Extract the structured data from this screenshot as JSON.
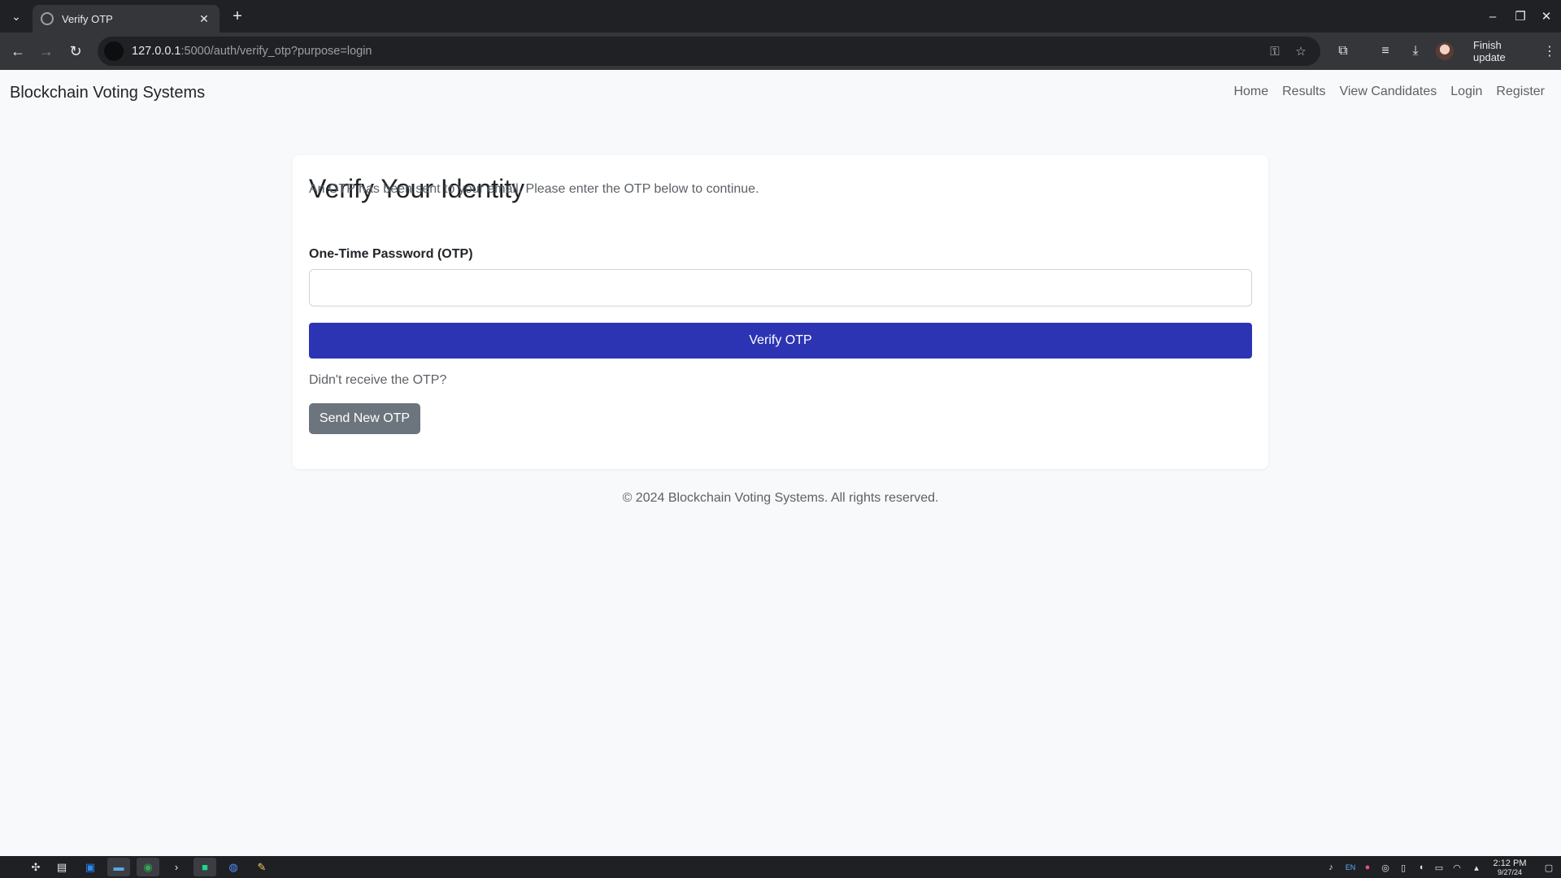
{
  "browser": {
    "tab": {
      "title": "Verify OTP",
      "close_glyph": "✕"
    },
    "tab_list_glyph": "⌄",
    "new_tab_glyph": "+",
    "window_controls": {
      "minimize": "–",
      "maximize": "❐",
      "close": "✕"
    },
    "nav": {
      "back": "←",
      "forward": "→",
      "reload": "↻"
    },
    "url": {
      "host": "127.0.0.1",
      "path": ":5000/auth/verify_otp?purpose=login"
    },
    "omnibox_icons": {
      "password_key": "⚿",
      "bookmark_star": "☆"
    },
    "toolbar_icons": {
      "extensions": "⧉",
      "media": "≡",
      "downloads": "⤓"
    },
    "update_button": {
      "label": "Finish update",
      "menu_glyph": "⋮"
    }
  },
  "navbar": {
    "brand": "Blockchain Voting Systems",
    "links": [
      "Home",
      "Results",
      "View Candidates",
      "Login",
      "Register"
    ]
  },
  "card": {
    "title": "Verify Your Identity",
    "description": "An OTP has been sent to your email. Please enter the OTP below to continue.",
    "otp_label": "One-Time Password (OTP)",
    "otp_value": "",
    "verify_button": "Verify OTP",
    "resend_prompt": "Didn't receive the OTP?",
    "resend_button": "Send New OTP"
  },
  "footer": {
    "text": "© 2024 Blockchain Voting Systems. All rights reserved."
  },
  "taskbar": {
    "apps": [
      "launcher-icon",
      "task-view-icon",
      "store-icon",
      "files-icon",
      "chrome-icon",
      "terminal-icon",
      "pycharm-icon",
      "browser-icon",
      "notes-icon"
    ],
    "language": "EN",
    "clock": {
      "time": "2:12 PM",
      "date": "9/27/24"
    }
  },
  "colors": {
    "primary_button": "#2d34b3",
    "secondary_button": "#6c757d",
    "page_background": "#f8f9fa",
    "browser_frame": "#202124",
    "browser_toolbar": "#35363a"
  }
}
